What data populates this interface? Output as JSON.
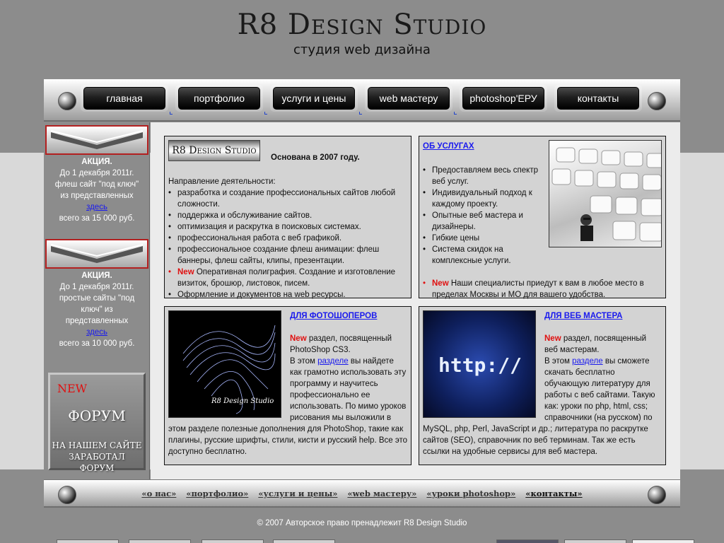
{
  "header": {
    "title": "R8 Design Studio",
    "subtitle": "студия web дизайна"
  },
  "nav": {
    "items": [
      "главная",
      "портфолио",
      "услуги и цены",
      "web мастеру",
      "photoshop'ЕРУ",
      "контакты"
    ]
  },
  "sidebar": {
    "promo1": {
      "title": "АКЦИЯ.",
      "line1": "До 1 декабря 2011г.",
      "line2": "флеш сайт \"под ключ\"",
      "line3": "из представленных",
      "link": "здесь",
      "price": "всего за 15 000 руб."
    },
    "promo2": {
      "title": "АКЦИЯ.",
      "line1": "До 1  декабря 2011г.",
      "line2": "простые сайты \"под",
      "line3": "ключ\" из",
      "line4": "представленных",
      "link": "здесь",
      "price": "всего за 10 000 руб."
    },
    "forum": {
      "new": "NEW",
      "title": "ФОРУМ",
      "line1": "НА НАШЕМ САЙТЕ",
      "line2": "ЗАРАБОТАЛ ФОРУМ"
    }
  },
  "about": {
    "logo_text": "R8 Design Studio",
    "founded": "Основана в 2007 году.",
    "direction": "Направление деятельности:",
    "items": [
      "разработка и создание профессиональных сайтов любой сложности.",
      "поддержка и обслуживание сайтов.",
      "оптимизация и раскрутка в поисковых системах.",
      "профессиональная работа с веб графикой.",
      "профессиональное создание флеш анимации: флеш баннеры, флеш сайты, клипы, презентации."
    ],
    "new_label": "New",
    "new_item": " Оперативная полиграфия. Создание и изготовление визиток, брошюр, листовок, писем.",
    "last_item": "Оформление и документов на web ресурсы."
  },
  "services": {
    "heading": "ОБ УСЛУГАХ",
    "items": [
      "Предоставляем весь спектр веб услуг.",
      "Индивидуальный подход к каждому проекту.",
      "Опытные веб мастера и дизайнеры.",
      "Гибкие цены",
      "Система скидок на комплексные услуги."
    ],
    "new_label": "New",
    "new_text": " Наши специалисты приедут к вам в любое место в пределах Москвы и МО для вашего удобства."
  },
  "photoshop": {
    "heading": "ДЛЯ ФОТОШОПЕРОВ",
    "new_label": "New",
    "p1": " раздел, посвященный PhotoShop CS3.",
    "p2a": "В этом ",
    "link": "разделе",
    "p2b": " вы найдете как грамотно использовать эту программу и научитесь профессионально ее использовать. По мимо уроков рисования мы выложили в этом разделе полезные дополнения для PhotoShop, такие как плагины, русские шрифты, стили, кисти и русский help. Все это доступно бесплатно.",
    "image_caption": "R8 Design Studio"
  },
  "webmaster": {
    "heading": "ДЛЯ ВЕБ МАСТЕРА",
    "new_label": "New",
    "p1": " раздел, посвященный веб мастерам.",
    "p2a": "В этом ",
    "link": "разделе",
    "p2b": " вы сможете скачать бесплатно обучающую литературу для работы с веб сайтами. Такую как: уроки по php, html, css; справочники (на русском) по MySQL, php, Perl, JavaScript и др.; литература по раскрутке сайтов (SEO), справочник по веб терминам. Так же есть ссылки на удобные сервисы для веб мастера.",
    "image_text": "http://"
  },
  "footer": {
    "links": [
      "«о нас»",
      "«портфолио»",
      "«услуги и цены»",
      "«web мастеру»",
      "«уроки photoshop»",
      "«контакты»"
    ],
    "copyright": "© 2007 Авторское право пренадлежит R8 Design Studio"
  }
}
